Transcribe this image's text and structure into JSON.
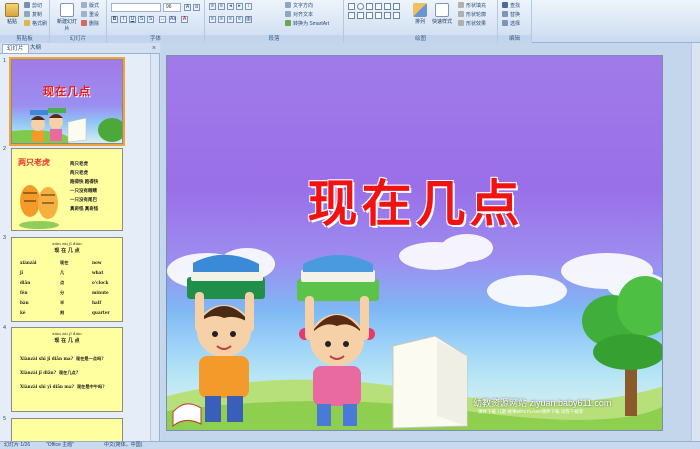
{
  "ribbon": {
    "clipboard": {
      "label": "剪贴板",
      "paste": "粘贴",
      "cut": "剪切",
      "copy": "复制",
      "format_painter": "格式刷"
    },
    "slides": {
      "label": "幻灯片",
      "new_slide": "新建幻灯片",
      "layout": "版式",
      "reset": "重设",
      "delete": "删除"
    },
    "font": {
      "label": "字体",
      "font_size": "96"
    },
    "paragraph": {
      "label": "段落",
      "text_direction": "文字方向",
      "align_text": "对齐文本",
      "smartart": "转换为 SmartArt"
    },
    "drawing": {
      "label": "绘图",
      "arrange": "排列",
      "quick_styles": "快速样式",
      "shape_fill": "形状填充",
      "shape_outline": "形状轮廓",
      "shape_effects": "形状效果"
    },
    "editing": {
      "label": "编辑",
      "find": "查找",
      "replace": "替换",
      "select": "选择"
    }
  },
  "leftpane": {
    "tabs": [
      "幻灯片",
      "大纲"
    ],
    "slides": [
      {
        "number": "1",
        "title": "现在几点"
      },
      {
        "number": "2",
        "title": "两只老虎",
        "lines": [
          "两只老虎",
          "两只老虎",
          "跑得快 跑得快",
          "一只没有眼睛",
          "一只没有尾巴",
          "真奇怪 真奇怪"
        ]
      },
      {
        "number": "3",
        "pinyin": "xiàn zài jǐ diǎn",
        "heading": "现 在 几 点",
        "rows": [
          [
            "xiànzài",
            "现在",
            "now"
          ],
          [
            "jǐ",
            "几",
            "what"
          ],
          [
            "diǎn",
            "点",
            "o'clock"
          ],
          [
            "fēn",
            "分",
            "minute"
          ],
          [
            "bàn",
            "半",
            "half"
          ],
          [
            "kè",
            "刻",
            "quarter"
          ]
        ]
      },
      {
        "number": "4",
        "pinyin": "xiàn zài jǐ diǎn",
        "heading": "现 在 几 点",
        "lines": [
          [
            "Xiànzài shì jǐ diǎn ma?",
            "现在是一点吗?"
          ],
          [
            "Xiànzài jǐ diǎn?",
            "现在几点?"
          ],
          [
            "Xiànzài shì yī diǎn ma?",
            "现在是中午吗?"
          ]
        ]
      },
      {
        "number": "5"
      }
    ]
  },
  "slide": {
    "title": "现在几点",
    "credit": "幼教资源网站  ziyuan.baby611.com",
    "credit_sub": "课件下载  儿歌  故事MP3  FLASH课件下载  试卷下载等"
  },
  "statusbar": {
    "slide_count": "幻灯片 1/26",
    "theme": "\"Office 主题\"",
    "language": "中文(简体，中国)"
  },
  "colors": {
    "title": "#f21212",
    "thumb_bg": "#ffffa0",
    "selected_outline": "#f2a23a"
  }
}
